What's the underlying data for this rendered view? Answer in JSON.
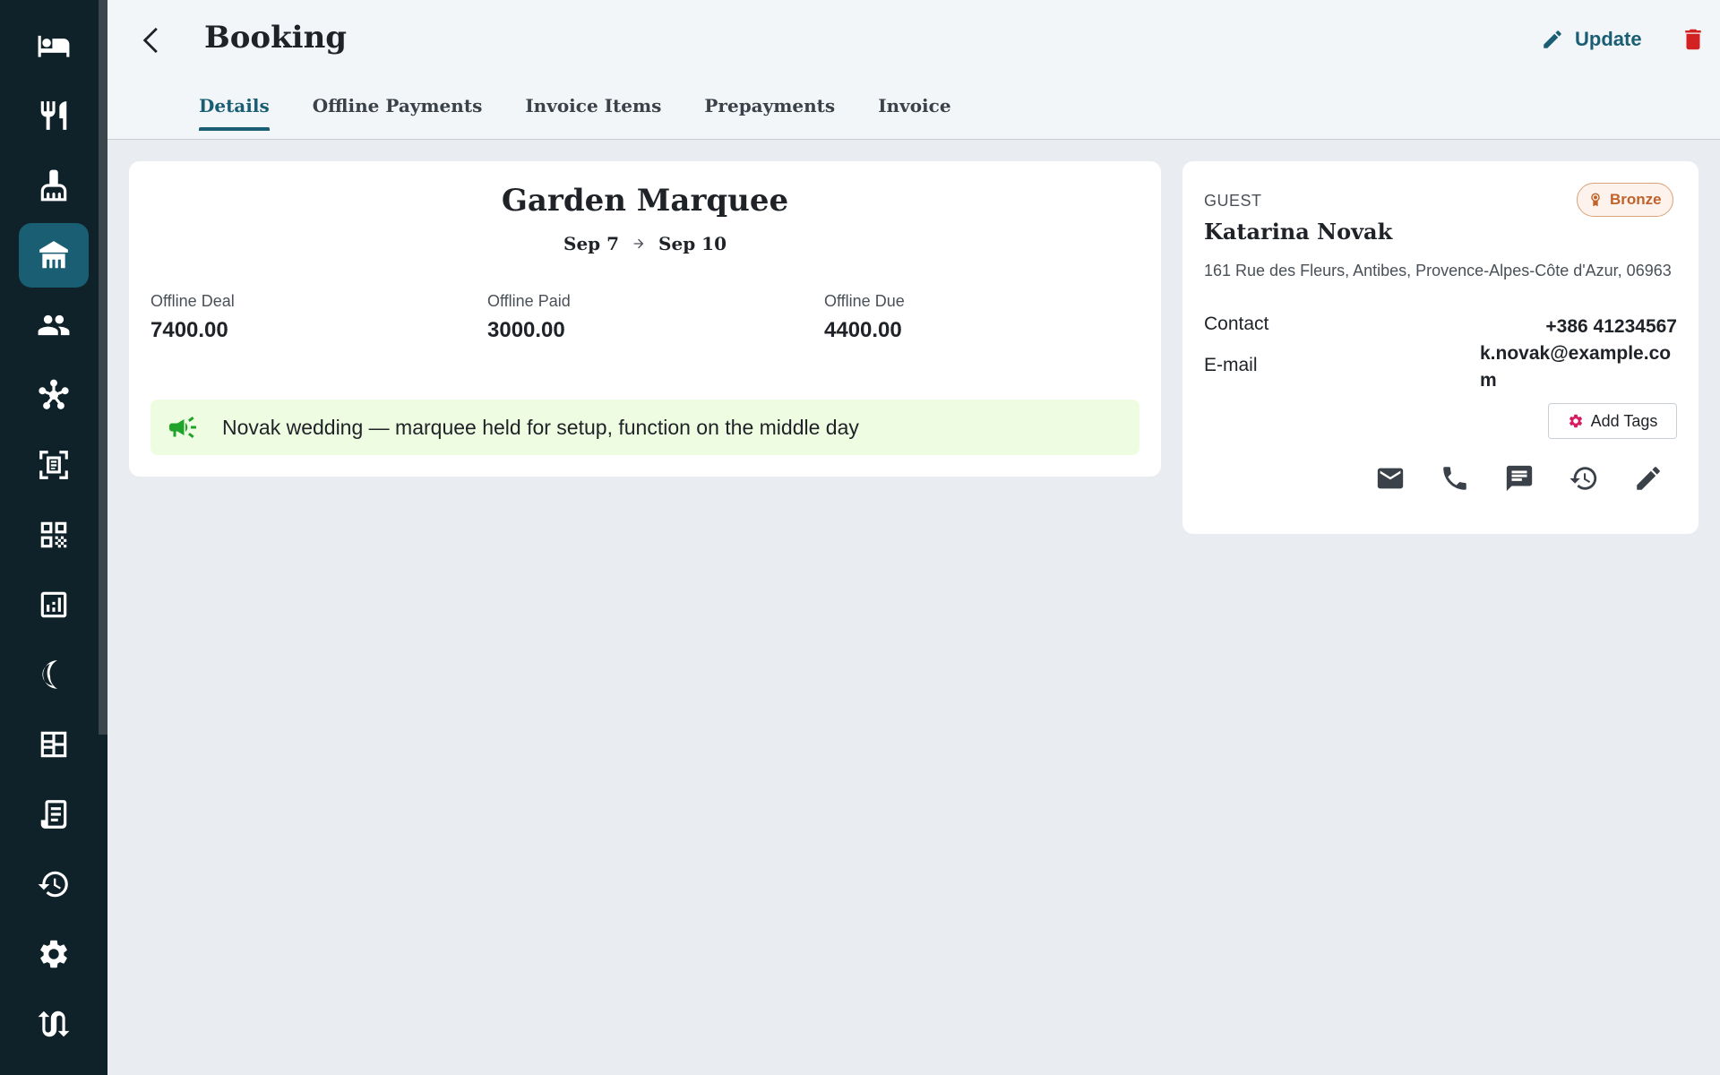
{
  "sidebar": {
    "items": [
      {
        "icon": "bed-icon"
      },
      {
        "icon": "restaurant-icon"
      },
      {
        "icon": "housekeeping-icon"
      },
      {
        "icon": "venue-icon",
        "active": true
      },
      {
        "icon": "people-icon"
      },
      {
        "icon": "network-icon"
      },
      {
        "icon": "scan-document-icon"
      },
      {
        "icon": "qr-code-icon"
      },
      {
        "icon": "analytics-icon"
      },
      {
        "icon": "night-audit-icon"
      },
      {
        "icon": "floor-plan-icon"
      },
      {
        "icon": "receipt-icon"
      },
      {
        "icon": "history-icon"
      },
      {
        "icon": "settings-icon"
      },
      {
        "icon": "sync-icon"
      }
    ],
    "colors": {
      "background": "#0f2129",
      "active": "#1a5e73"
    }
  },
  "header": {
    "title": "Booking",
    "update_label": "Update",
    "tabs": [
      {
        "label": "Details",
        "active": true
      },
      {
        "label": "Offline Payments"
      },
      {
        "label": "Invoice Items"
      },
      {
        "label": "Prepayments"
      },
      {
        "label": "Invoice"
      }
    ]
  },
  "booking": {
    "room_name": "Garden Marquee",
    "date_from": "Sep 7",
    "date_to": "Sep 10",
    "stats": [
      {
        "label": "Offline Deal",
        "value": "7400.00"
      },
      {
        "label": "Offline Paid",
        "value": "3000.00"
      },
      {
        "label": "Offline Due",
        "value": "4400.00"
      }
    ],
    "note": "Novak wedding — marquee held for setup, function on the middle day"
  },
  "guest": {
    "label": "GUEST",
    "tier": "Bronze",
    "name": "Katarina Novak",
    "address": "161 Rue des Fleurs, Antibes, Provence-Alpes-Côte d'Azur, 06963",
    "contact_label": "Contact",
    "contact_value": "+386 41234567",
    "email_label": "E-mail",
    "email_value": "k.novak@example.com",
    "add_tags_label": "Add Tags"
  },
  "colors": {
    "accent": "#1a5e73",
    "danger": "#d32222",
    "note_bg": "#eefce1",
    "note_icon": "#1fa32a",
    "tier": "#c0622a"
  }
}
